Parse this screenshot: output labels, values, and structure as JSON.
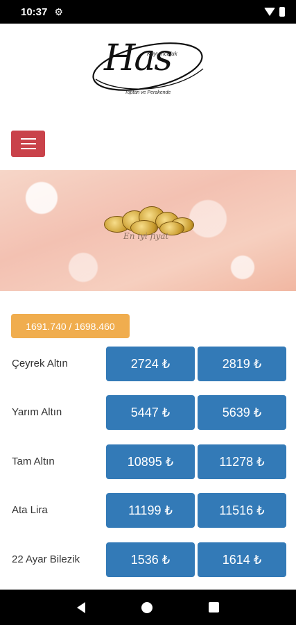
{
  "status_bar": {
    "time": "10:37"
  },
  "logo": {
    "brand": "Has",
    "subtitle": "Kuyumculuk",
    "tagline": "Toptan ve Perakende"
  },
  "banner": {
    "caption": "En iyi fiyat"
  },
  "rate": {
    "text": "1691.740 / 1698.460"
  },
  "rows": [
    {
      "label": "Çeyrek Altın",
      "buy": "2724 ₺",
      "sell": "2819 ₺"
    },
    {
      "label": "Yarım Altın",
      "buy": "5447 ₺",
      "sell": "5639 ₺"
    },
    {
      "label": "Tam Altın",
      "buy": "10895 ₺",
      "sell": "11278 ₺"
    },
    {
      "label": "Ata Lira",
      "buy": "11199 ₺",
      "sell": "11516 ₺"
    },
    {
      "label": "22 Ayar Bilezik",
      "buy": "1536 ₺",
      "sell": "1614 ₺"
    }
  ],
  "icons": {
    "settings": "gear-icon",
    "wifi": "wifi-icon",
    "battery": "battery-icon",
    "menu": "hamburger-icon",
    "back": "back-icon",
    "home": "home-icon",
    "recents": "recents-icon"
  },
  "colors": {
    "menu_button": "#c9424a",
    "rate_badge": "#f0ad4e",
    "price_button": "#337ab7"
  }
}
